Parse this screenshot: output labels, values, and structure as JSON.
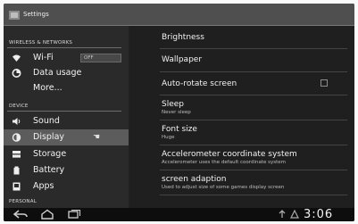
{
  "window": {
    "title": "Settings",
    "app_icon": "settings-app-icon"
  },
  "sidebar": {
    "sections": [
      {
        "header": "WIRELESS & NETWORKS",
        "items": [
          {
            "label": "Wi-Fi",
            "icon": "wifi-icon",
            "toggle_label": "OFF"
          },
          {
            "label": "Data usage",
            "icon": "data-usage-icon"
          },
          {
            "label": "More...",
            "icon": ""
          }
        ]
      },
      {
        "header": "DEVICE",
        "items": [
          {
            "label": "Sound",
            "icon": "sound-icon"
          },
          {
            "label": "Display",
            "icon": "display-icon",
            "selected": true
          },
          {
            "label": "Storage",
            "icon": "storage-icon"
          },
          {
            "label": "Battery",
            "icon": "battery-icon"
          },
          {
            "label": "Apps",
            "icon": "apps-icon"
          }
        ]
      },
      {
        "header": "PERSONAL",
        "items": []
      }
    ]
  },
  "display_settings": [
    {
      "title": "Brightness",
      "subtitle": ""
    },
    {
      "title": "Wallpaper",
      "subtitle": ""
    },
    {
      "title": "Auto-rotate screen",
      "subtitle": "",
      "checkbox": true
    },
    {
      "title": "Sleep",
      "subtitle": "Never sleep"
    },
    {
      "title": "Font size",
      "subtitle": "Huge"
    },
    {
      "title": "Accelerometer coordinate system",
      "subtitle": "Accelerometer uses the default coordinate system"
    },
    {
      "title": "screen adaption",
      "subtitle": "Used to adjust size of some games display screen"
    }
  ],
  "navbar": {
    "back_icon": "back-icon",
    "home_icon": "home-icon",
    "recent_apps_icon": "recent-apps-icon",
    "status_icons": [
      "usb-icon",
      "notification-icon"
    ],
    "clock": "3:06"
  },
  "colors": {
    "sidebar_bg": "#2a2a2a",
    "selected_bg": "#5c5c5c",
    "content_bg": "#1f1f1f",
    "navbar_bg": "#0d0d0d"
  }
}
